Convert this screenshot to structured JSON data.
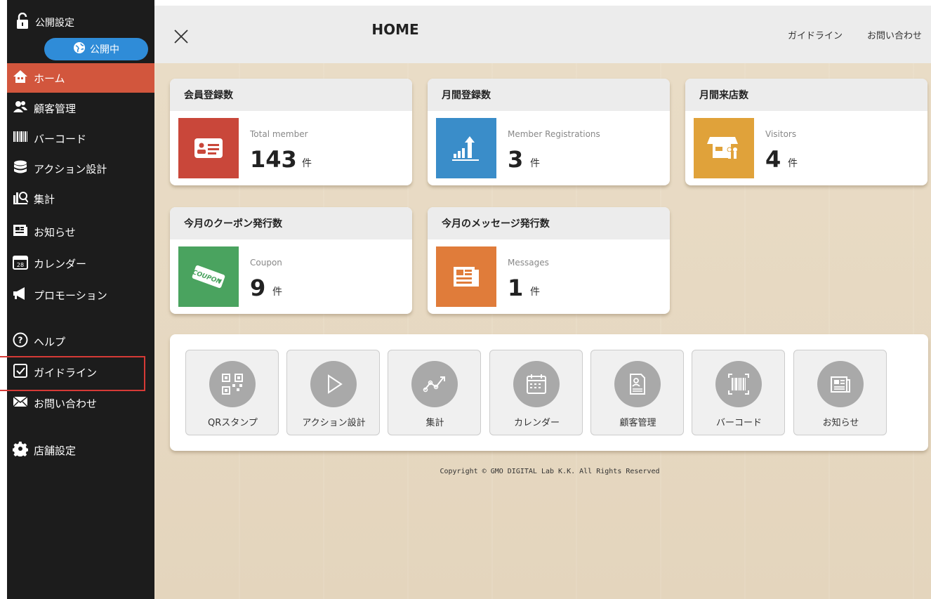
{
  "sidebar": {
    "publish_label": "公開設定",
    "publish_status": "公開中",
    "items": [
      {
        "label": "ホーム"
      },
      {
        "label": "顧客管理"
      },
      {
        "label": "バーコード"
      },
      {
        "label": "アクション設計"
      },
      {
        "label": "集計"
      },
      {
        "label": "お知らせ"
      },
      {
        "label": "カレンダー"
      },
      {
        "label": "プロモーション"
      },
      {
        "label": "ヘルプ"
      },
      {
        "label": "ガイドライン"
      },
      {
        "label": "お問い合わせ"
      },
      {
        "label": "店舗設定"
      }
    ]
  },
  "header": {
    "title": "HOME",
    "guideline_link": "ガイドライン",
    "contact_link": "お問い合わせ"
  },
  "cards": [
    {
      "title": "会員登録数",
      "sub": "Total member",
      "value": "143",
      "unit": "件",
      "color": "#c9473a"
    },
    {
      "title": "月間登録数",
      "sub": "Member Registrations",
      "value": "3",
      "unit": "件",
      "color": "#3a8dc9"
    },
    {
      "title": "月間来店数",
      "sub": "Visitors",
      "value": "4",
      "unit": "件",
      "color": "#e0a23a"
    },
    {
      "title": "今月のクーポン発行数",
      "sub": "Coupon",
      "value": "9",
      "unit": "件",
      "color": "#4aa35f"
    },
    {
      "title": "今月のメッセージ発行数",
      "sub": "Messages",
      "value": "1",
      "unit": "件",
      "color": "#e07c3a"
    }
  ],
  "shortcuts": [
    {
      "label": "QRスタンプ",
      "icon": "qr-icon"
    },
    {
      "label": "アクション設計",
      "icon": "play-icon"
    },
    {
      "label": "集計",
      "icon": "trend-icon"
    },
    {
      "label": "カレンダー",
      "icon": "calendar-icon"
    },
    {
      "label": "顧客管理",
      "icon": "profile-icon"
    },
    {
      "label": "バーコード",
      "icon": "barcode-icon"
    },
    {
      "label": "お知らせ",
      "icon": "newspaper-icon"
    }
  ],
  "footer": {
    "copyright": "Copyright © GMO DIGITAL Lab K.K. All Rights Reserved"
  }
}
